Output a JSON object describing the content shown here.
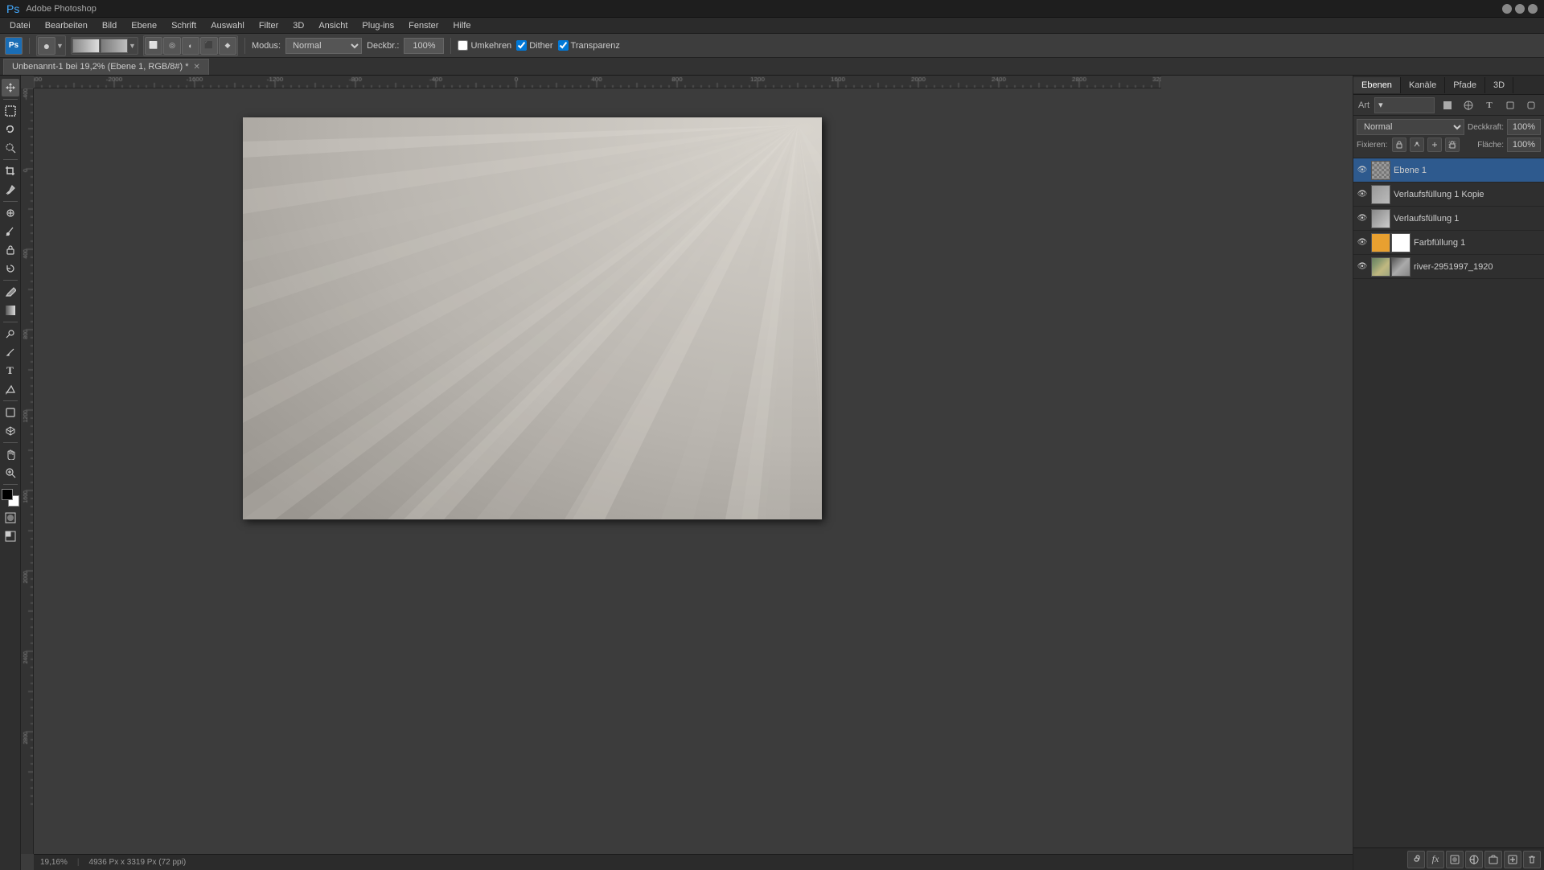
{
  "titleBar": {
    "appName": "Adobe Photoshop",
    "minimize": "—",
    "maximize": "□",
    "close": "✕"
  },
  "menuBar": {
    "items": [
      "Datei",
      "Bearbeiten",
      "Bild",
      "Ebene",
      "Schrift",
      "Auswahl",
      "Filter",
      "3D",
      "Ansicht",
      "Plug-ins",
      "Fenster",
      "Hilfe"
    ]
  },
  "optionsBar": {
    "modeLabel": "Modus:",
    "modeValue": "Normal",
    "opacityLabel": "Deckbr.:",
    "opacityValue": "100%",
    "reverseLabel": "Umkehren",
    "ditherLabel": "Dither",
    "transparencyLabel": "Transparenz"
  },
  "docTab": {
    "title": "Unbenannt-1 bei 19,2% (Ebene 1, RGB/8#) *"
  },
  "statusBar": {
    "zoom": "19,16%",
    "dimensions": "4936 Px x 3319 Px (72 ppi)"
  },
  "rightPanel": {
    "tabs": [
      "Ebenen",
      "Kanäle",
      "Pfade",
      "3D"
    ],
    "artLabel": "Art",
    "blendMode": "Normal",
    "opacityLabel": "Deckkraft:",
    "opacityValue": "100%",
    "fillLabel": "Fläche:",
    "fillValue": "100%",
    "focusLabel": "Fixieren:",
    "layers": [
      {
        "name": "Ebene 1",
        "visible": true,
        "selected": true,
        "type": "normal"
      },
      {
        "name": "Verlaufsfüllung 1 Kopie",
        "visible": true,
        "selected": false,
        "type": "gradient"
      },
      {
        "name": "Verlaufsfüllung 1",
        "visible": true,
        "selected": false,
        "type": "gradient"
      },
      {
        "name": "Farbfüllung 1",
        "visible": true,
        "selected": false,
        "type": "color"
      },
      {
        "name": "river-2951997_1920",
        "visible": true,
        "selected": false,
        "type": "image"
      }
    ]
  },
  "tools": {
    "list": [
      {
        "name": "move",
        "icon": "↖",
        "label": "Verschieben"
      },
      {
        "name": "marquee-rect",
        "icon": "⬜",
        "label": "Rechteckige Auswahl"
      },
      {
        "name": "lasso",
        "icon": "⌒",
        "label": "Lasso"
      },
      {
        "name": "quick-select",
        "icon": "✦",
        "label": "Schnellauswahl"
      },
      {
        "name": "crop",
        "icon": "⛶",
        "label": "Freistellen"
      },
      {
        "name": "eyedropper",
        "icon": "💉",
        "label": "Pipette"
      },
      {
        "name": "heal",
        "icon": "⊕",
        "label": "Reparaturpinsel"
      },
      {
        "name": "brush",
        "icon": "🖌",
        "label": "Pinsel"
      },
      {
        "name": "stamp",
        "icon": "◻",
        "label": "Kopierstempel"
      },
      {
        "name": "history-brush",
        "icon": "↩",
        "label": "Protokollpinsel"
      },
      {
        "name": "eraser",
        "icon": "◻",
        "label": "Radiergummi"
      },
      {
        "name": "gradient",
        "icon": "▣",
        "label": "Verlauf"
      },
      {
        "name": "dodge",
        "icon": "◯",
        "label": "Abwedler"
      },
      {
        "name": "pen",
        "icon": "✒",
        "label": "Zeichenstift"
      },
      {
        "name": "text",
        "icon": "T",
        "label": "Text"
      },
      {
        "name": "path-select",
        "icon": "⬦",
        "label": "Pfadauswahl"
      },
      {
        "name": "shape",
        "icon": "◻",
        "label": "Form"
      },
      {
        "name": "hand",
        "icon": "✋",
        "label": "Hand"
      },
      {
        "name": "zoom",
        "icon": "🔍",
        "label": "Zoom"
      }
    ]
  }
}
